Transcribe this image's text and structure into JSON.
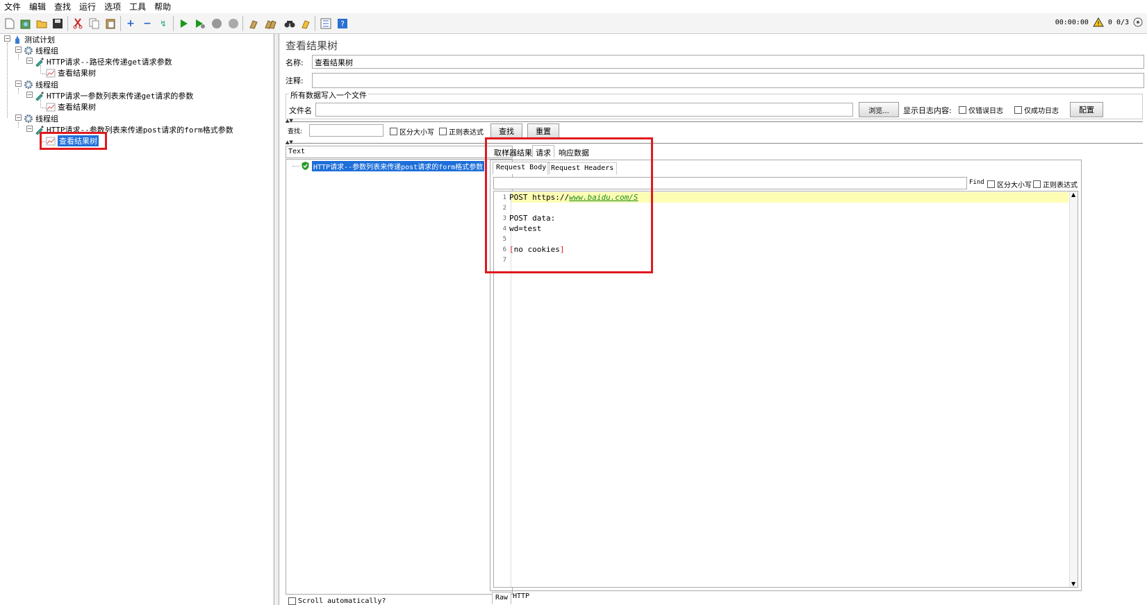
{
  "menu": [
    "文件",
    "编辑",
    "查找",
    "运行",
    "选项",
    "工具",
    "帮助"
  ],
  "toolbar": {
    "icons": [
      "new-file-icon",
      "template-icon",
      "open-icon",
      "save-icon",
      "cut-icon",
      "copy-icon",
      "paste-icon",
      "expand-icon",
      "collapse-icon",
      "toggle-icon",
      "start-icon",
      "start-no-pause-icon",
      "stop-icon",
      "shutdown-icon",
      "clear-icon",
      "clear-all-icon",
      "search-icon",
      "reset-search-icon",
      "function-helper-icon",
      "help-icon"
    ],
    "timer": "00:00:00",
    "warn_count": "0",
    "threads": "0/3"
  },
  "tree": {
    "root": "测试计划",
    "groups": [
      {
        "label": "线程组",
        "request": "HTTP请求--路径来传递get请求参数",
        "listener": "查看结果树"
      },
      {
        "label": "线程组",
        "request": "HTTP请求一参数列表来传递get请求的参数",
        "listener": "查看结果树"
      },
      {
        "label": "线程组",
        "request": "HTTP请求--参数列表来传递post请求的form格式参数",
        "listener": "查看结果树"
      }
    ]
  },
  "panel": {
    "title": "查看结果树",
    "name_label": "名称:",
    "name_value": "查看结果树",
    "comment_label": "注释:",
    "comment_value": "",
    "file_group_title": "所有数据写入一个文件",
    "file_label": "文件名",
    "file_value": "",
    "browse": "浏览...",
    "log_content_label": "显示日志内容:",
    "errors_only": "仅错误日志",
    "success_only": "仅成功日志",
    "configure": "配置"
  },
  "search": {
    "label": "查找:",
    "value": "",
    "case_sensitive": "区分大小写",
    "regex": "正则表达式",
    "find_btn": "查找",
    "reset_btn": "重置"
  },
  "results": {
    "renderer": "Text",
    "sample": "HTTP请求--参数列表来传递post请求的form格式参数",
    "scroll_auto": "Scroll automatically?"
  },
  "detail": {
    "tabs": [
      "取样器结果",
      "请求",
      "响应数据"
    ],
    "subtabs": [
      "Request Body",
      "Request Headers"
    ],
    "find_label": "Find",
    "find_value": "",
    "case_sensitive": "区分大小写",
    "regex": "正则表达式",
    "bottom_tabs": [
      "Raw",
      "HTTP"
    ],
    "code_lines": [
      {
        "n": "1",
        "text": "POST https://",
        "link": "www.baidu.com/S"
      },
      {
        "n": "2",
        "text": ""
      },
      {
        "n": "3",
        "text": "POST data:"
      },
      {
        "n": "4",
        "text": "wd=test"
      },
      {
        "n": "5",
        "text": ""
      },
      {
        "n": "6",
        "bracket_open": "[",
        "text": "no cookies",
        "bracket_close": "]"
      },
      {
        "n": "7",
        "text": ""
      }
    ]
  },
  "colors": {
    "highlight_red": "#e0191e",
    "selection_blue": "#1e6fd9",
    "line_highlight": "#fdfdb4",
    "link_green": "#1a8c1a"
  }
}
